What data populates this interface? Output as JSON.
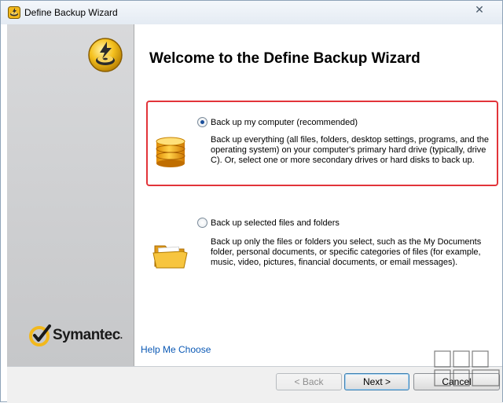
{
  "window": {
    "title": "Define Backup Wizard",
    "close_glyph": "✕"
  },
  "sidebar": {
    "brand": "Symantec",
    "brand_mark": "."
  },
  "main": {
    "heading": "Welcome to the Define Backup Wizard",
    "options": [
      {
        "label": "Back up my computer (recommended)",
        "selected": true,
        "icon": "database-icon",
        "description": "Back up everything (all files, folders, desktop settings, programs, and the operating system) on your computer's primary hard drive (typically, drive C). Or, select one or more secondary drives or hard disks to back up."
      },
      {
        "label": "Back up selected files and folders",
        "selected": false,
        "icon": "folder-icon",
        "description": "Back up only the files or folders you select, such as the My Documents folder, personal documents, or specific categories of files (for example, music, video, pictures, financial documents, or email messages)."
      }
    ],
    "help_link": "Help Me Choose"
  },
  "buttons": {
    "back": "< Back",
    "next": "Next >",
    "cancel": "Cancel"
  },
  "colors": {
    "highlight": "#e2343a",
    "link": "#0b59b5",
    "accent_gold": "#f2b81c"
  }
}
